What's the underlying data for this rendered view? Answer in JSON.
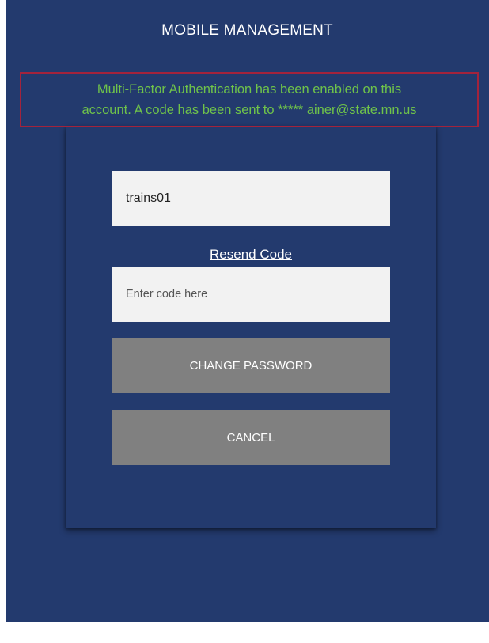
{
  "header": {
    "title": "MOBILE MANAGEMENT"
  },
  "banner": {
    "line1": "Multi-Factor Authentication has been enabled on this",
    "line2": "account. A code has been sent to ***** ainer@state.mn.us"
  },
  "form": {
    "username_value": "trains01",
    "resend_label": "Resend Code",
    "code_placeholder": "Enter code here",
    "change_password_label": "CHANGE PASSWORD",
    "cancel_label": "CANCEL"
  },
  "colors": {
    "background": "#233a6e",
    "banner_text": "#6fc34a",
    "banner_border": "#a3233c",
    "button": "#808080",
    "input": "#f2f2f2"
  }
}
